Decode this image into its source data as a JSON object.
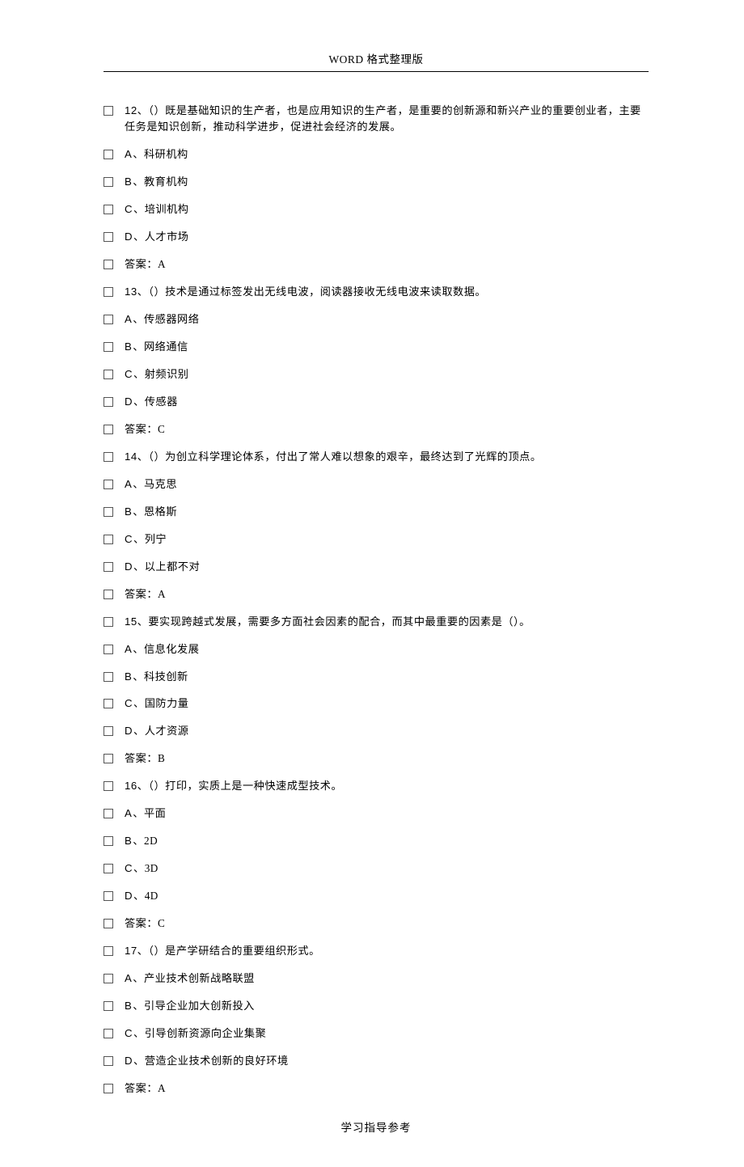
{
  "header": "WORD 格式整理版",
  "footer": "学习指导参考",
  "questions": [
    {
      "num": "12",
      "text": "、（）既是基础知识的生产者，也是应用知识的生产者，是重要的创新源和新兴产业的重要创业者，主要任务是知识创新，推动科学进步，促进社会经济的发展。",
      "opts": [
        {
          "l": "A",
          "t": "、科研机构"
        },
        {
          "l": "B",
          "t": "、教育机构"
        },
        {
          "l": "C",
          "t": "、培训机构"
        },
        {
          "l": "D",
          "t": "、人才市场"
        }
      ],
      "ans": "答案：A"
    },
    {
      "num": "13",
      "text": "、（）技术是通过标签发出无线电波，阅读器接收无线电波来读取数据。",
      "opts": [
        {
          "l": "A",
          "t": "、传感器网络"
        },
        {
          "l": "B",
          "t": "、网络通信"
        },
        {
          "l": "C",
          "t": "、射频识别"
        },
        {
          "l": "D",
          "t": "、传感器"
        }
      ],
      "ans": "答案：C"
    },
    {
      "num": "14",
      "text": "、（）为创立科学理论体系，付出了常人难以想象的艰辛，最终达到了光辉的顶点。",
      "opts": [
        {
          "l": "A",
          "t": "、马克思"
        },
        {
          "l": "B",
          "t": "、恩格斯"
        },
        {
          "l": "C",
          "t": "、列宁"
        },
        {
          "l": "D",
          "t": "、以上都不对"
        }
      ],
      "ans": "答案：A"
    },
    {
      "num": "15",
      "text": "、要实现跨越式发展，需要多方面社会因素的配合，而其中最重要的因素是（）。",
      "opts": [
        {
          "l": "A",
          "t": "、信息化发展"
        },
        {
          "l": "B",
          "t": "、科技创新"
        },
        {
          "l": "C",
          "t": "、国防力量"
        },
        {
          "l": "D",
          "t": "、人才资源"
        }
      ],
      "ans": "答案：B"
    },
    {
      "num": "16",
      "text": "、（）打印，实质上是一种快速成型技术。",
      "opts": [
        {
          "l": "A",
          "t": "、平面"
        },
        {
          "l": "B",
          "t": "、2D"
        },
        {
          "l": "C",
          "t": "、3D"
        },
        {
          "l": "D",
          "t": "、4D"
        }
      ],
      "ans": "答案：C"
    },
    {
      "num": "17",
      "text": "、（）是产学研结合的重要组织形式。",
      "opts": [
        {
          "l": "A",
          "t": "、产业技术创新战略联盟"
        },
        {
          "l": "B",
          "t": "、引导企业加大创新投入"
        },
        {
          "l": "C",
          "t": "、引导创新资源向企业集聚"
        },
        {
          "l": "D",
          "t": "、营造企业技术创新的良好环境"
        }
      ],
      "ans": "答案：A"
    }
  ]
}
